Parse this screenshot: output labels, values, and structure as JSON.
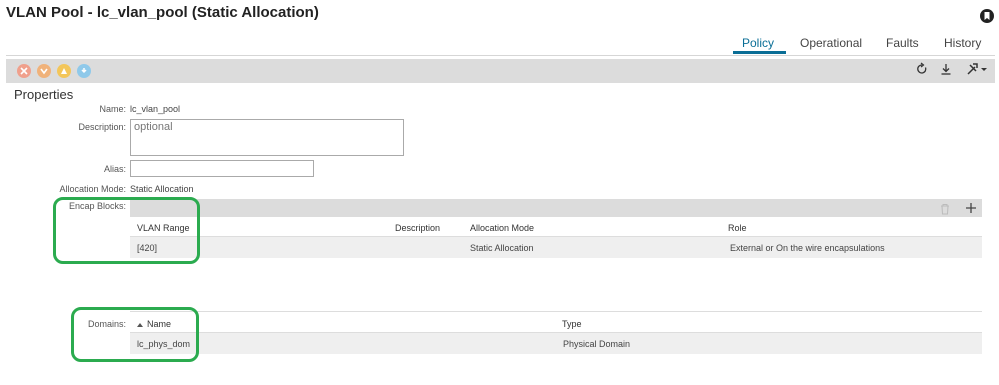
{
  "header": {
    "title": "VLAN Pool - lc_vlan_pool (Static Allocation)"
  },
  "tabs": [
    {
      "label": "Policy",
      "active": true
    },
    {
      "label": "Operational",
      "active": false
    },
    {
      "label": "Faults",
      "active": false
    },
    {
      "label": "History",
      "active": false
    }
  ],
  "toolbar": {
    "left_icons": [
      {
        "name": "close-circle-icon",
        "color": "#f0a08c"
      },
      {
        "name": "down-arrow-icon",
        "color": "#f0b27a"
      },
      {
        "name": "warning-icon",
        "color": "#f3c65a"
      },
      {
        "name": "info-icon",
        "color": "#8fc9ea"
      }
    ],
    "right_icons": [
      "refresh-icon",
      "download-icon",
      "tools-icon"
    ]
  },
  "properties": {
    "section_title": "Properties",
    "name_label": "Name:",
    "name_value": "lc_vlan_pool",
    "description_label": "Description:",
    "description_placeholder": "optional",
    "alias_label": "Alias:",
    "alias_value": "",
    "allocation_mode_label": "Allocation Mode:",
    "allocation_mode_value": "Static Allocation"
  },
  "encap_blocks": {
    "label": "Encap Blocks:",
    "columns": [
      "VLAN Range",
      "Description",
      "Allocation Mode",
      "Role"
    ],
    "rows": [
      {
        "vlan_range": "[420]",
        "description": "",
        "allocation_mode": "Static Allocation",
        "role": "External or On the wire encapsulations"
      }
    ]
  },
  "domains": {
    "label": "Domains:",
    "columns": [
      "Name",
      "Type"
    ],
    "rows": [
      {
        "name": "lc_phys_dom",
        "type": "Physical Domain"
      }
    ]
  },
  "colors": {
    "accent": "#0a6e96",
    "highlight": "#2bab4f",
    "toolbar": "#dcdcdc"
  }
}
